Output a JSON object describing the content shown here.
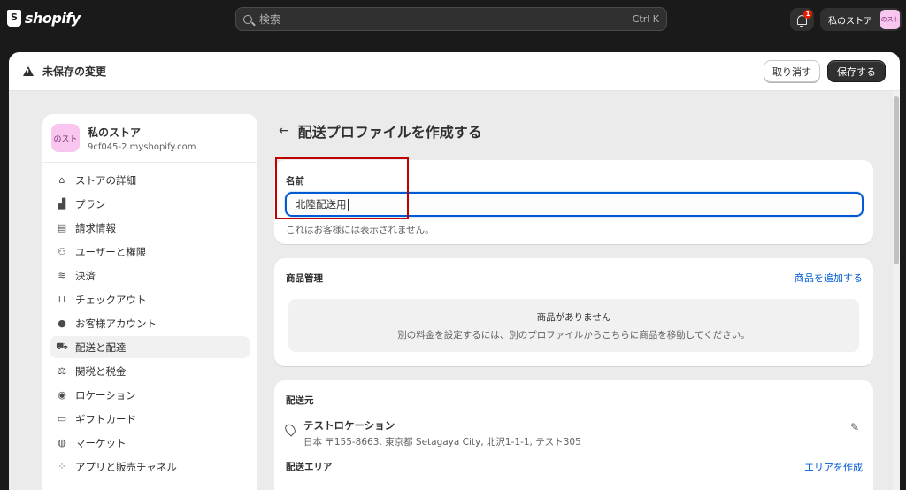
{
  "topbar": {
    "logo_text": "shopify",
    "search_placeholder": "検索",
    "search_shortcut": "Ctrl K",
    "notification_count": "1",
    "store_button_label": "私のストア",
    "store_avatar_text": "のスト"
  },
  "unsaved": {
    "title": "未保存の変更",
    "discard_label": "取り消す",
    "save_label": "保存する"
  },
  "nav": {
    "store_name": "私のストア",
    "store_url": "9cf045-2.myshopify.com",
    "avatar_text": "のスト",
    "items": [
      {
        "label": "ストアの詳細",
        "icon": "store-icon"
      },
      {
        "label": "プラン",
        "icon": "plan-icon"
      },
      {
        "label": "請求情報",
        "icon": "billing-icon"
      },
      {
        "label": "ユーザーと権限",
        "icon": "users-icon"
      },
      {
        "label": "決済",
        "icon": "payments-icon"
      },
      {
        "label": "チェックアウト",
        "icon": "cart-icon"
      },
      {
        "label": "お客様アカウント",
        "icon": "person-icon"
      },
      {
        "label": "配送と配達",
        "icon": "truck-icon"
      },
      {
        "label": "関税と税金",
        "icon": "tax-icon"
      },
      {
        "label": "ロケーション",
        "icon": "location-icon"
      },
      {
        "label": "ギフトカード",
        "icon": "giftcard-icon"
      },
      {
        "label": "マーケット",
        "icon": "globe-icon"
      },
      {
        "label": "アプリと販売チャネル",
        "icon": "apps-icon"
      }
    ],
    "active_index": 7
  },
  "page": {
    "title": "配送プロファイルを作成する"
  },
  "name_card": {
    "label": "名前",
    "value": "北陸配送用",
    "help": "これはお客様には表示されません。"
  },
  "products_card": {
    "title": "商品管理",
    "link": "商品を追加する",
    "empty_title": "商品がありません",
    "empty_desc": "別の料金を設定するには、別のプロファイルからこちらに商品を移動してください。"
  },
  "origin_card": {
    "title": "配送元",
    "location_name": "テストロケーション",
    "location_address": "日本 〒155-8663, 東京都 Setagaya City, 北沢1-1-1, テスト305",
    "area_title": "配送エリア",
    "area_link": "エリアを作成"
  },
  "colors": {
    "accent": "#005bd3",
    "topbar": "#1a1a1a",
    "highlight": "#c00000",
    "avatar": "#f9c6f0"
  }
}
